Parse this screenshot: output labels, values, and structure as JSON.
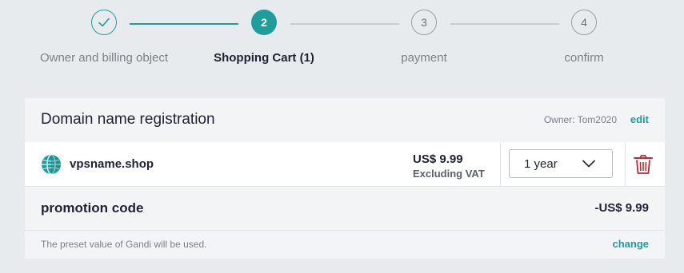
{
  "stepper": {
    "steps": [
      {
        "number": "",
        "label": "Owner and billing object",
        "state": "done",
        "icon": "check-icon"
      },
      {
        "number": "2",
        "label": "Shopping Cart (1)",
        "state": "active"
      },
      {
        "number": "3",
        "label": "payment",
        "state": "todo"
      },
      {
        "number": "4",
        "label": "confirm",
        "state": "todo"
      }
    ]
  },
  "cart": {
    "title": "Domain name registration",
    "owner": "Owner: Tom2020",
    "edit_label": "edit",
    "item": {
      "icon": "globe-icon",
      "domain": "vpsname.shop",
      "price": "US$ 9.99",
      "price_note": "Excluding VAT",
      "duration": "1 year",
      "delete_icon": "trash-icon"
    },
    "promo": {
      "label": "promotion code",
      "value": "-US$ 9.99"
    },
    "footer": {
      "text": "The preset value of Gandi will be used.",
      "change_label": "change"
    }
  },
  "colors": {
    "accent": "#1f9c9c",
    "danger": "#c8262c",
    "background": "#e8ebed"
  }
}
